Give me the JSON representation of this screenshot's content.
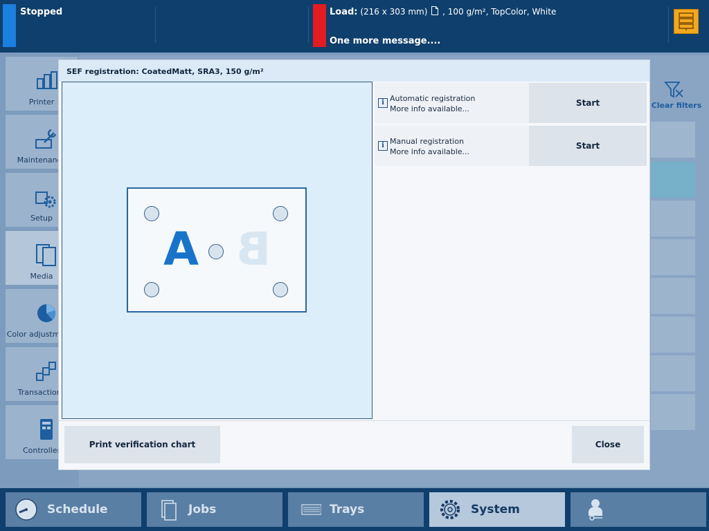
{
  "status": {
    "state": "Stopped",
    "load_label": "Load:",
    "load_size": "(216 x 303 mm)",
    "load_details": ", 100 g/m², TopColor, White",
    "message": "One more message....",
    "colors": {
      "stopped": "#1b7fe0",
      "alert": "#e31b23",
      "server": "#f4a820"
    }
  },
  "sidebar": {
    "items": [
      {
        "label": "Printer"
      },
      {
        "label": "Maintenance"
      },
      {
        "label": "Setup"
      },
      {
        "label": "Media"
      },
      {
        "label": "Color adjustments"
      },
      {
        "label": "Transactions"
      },
      {
        "label": "Controller"
      }
    ]
  },
  "filters": {
    "clear_label": "Clear filters"
  },
  "dialog": {
    "title": "SEF registration: CoatedMatt, SRA3, 150 g/m²",
    "preview": {
      "front_letter": "A",
      "back_letter": "B"
    },
    "rows": [
      {
        "name": "Automatic registration",
        "info": "More info available...",
        "button": "Start"
      },
      {
        "name": "Manual registration",
        "info": "More info available...",
        "button": "Start"
      }
    ],
    "print_chart_label": "Print verification chart",
    "close_label": "Close"
  },
  "nav": {
    "tabs": [
      {
        "label": "Schedule"
      },
      {
        "label": "Jobs"
      },
      {
        "label": "Trays"
      },
      {
        "label": "System"
      },
      {
        "label": ""
      }
    ]
  }
}
